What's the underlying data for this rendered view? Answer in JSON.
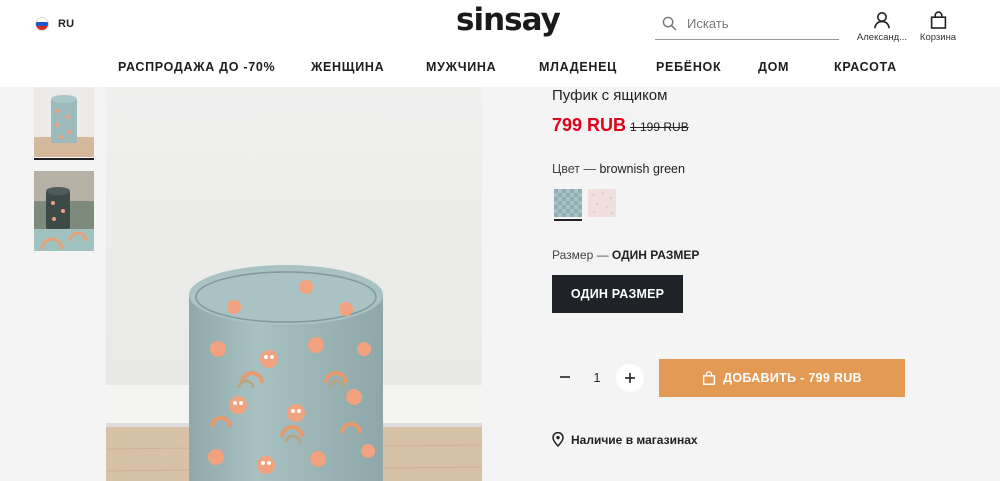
{
  "header": {
    "language": "RU",
    "logo": "sinsay",
    "search_placeholder": "Искать",
    "account_label": "Александ...",
    "cart_label": "Корзина"
  },
  "nav": {
    "items": [
      "РАСПРОДАЖА ДО -70%",
      "ЖЕНЩИНА",
      "МУЖЧИНА",
      "МЛАДЕНЕЦ",
      "РЕБЁНОК",
      "ДОМ",
      "КРАСОТА"
    ]
  },
  "product": {
    "title": "Пуфик с ящиком",
    "price": "799 RUB",
    "old_price": "1 199 RUB",
    "color_label": "Цвет — ",
    "color_value": "brownish green",
    "size_label": "Размер — ",
    "size_value": "ОДИН РАЗМЕР",
    "size_button": "ОДИН РАЗМЕР",
    "quantity": "1",
    "add_button": "ДОБАВИТЬ - 799 RUB",
    "stores_link": "Наличие в магазинах"
  },
  "colors": {
    "price_red": "#e2001a",
    "add_button_bg": "#e39a55",
    "size_button_bg": "#1f2227",
    "swatch_1": "#a8c3c7",
    "swatch_2": "#efe0de"
  },
  "icons": {
    "flag": "russia-flag-icon",
    "search": "search-icon",
    "account": "user-icon",
    "cart": "shopping-bag-icon",
    "minus": "minus-icon",
    "plus": "plus-icon",
    "add": "shopping-bag-icon",
    "stores": "map-pin-icon"
  }
}
